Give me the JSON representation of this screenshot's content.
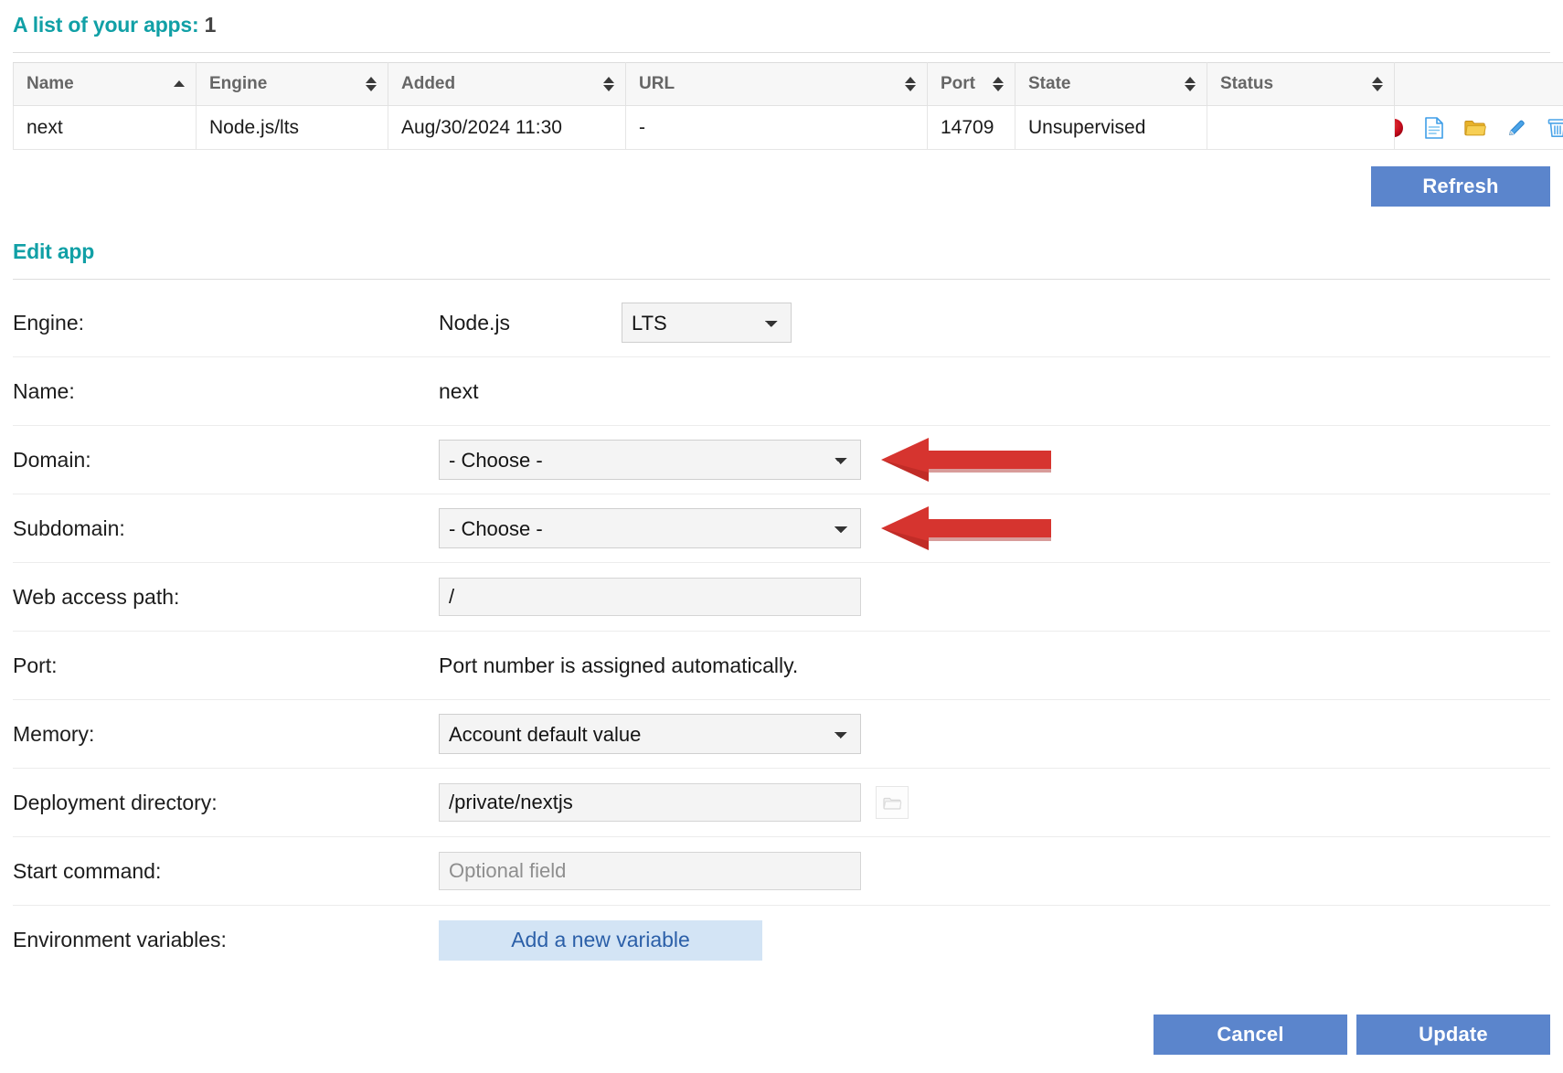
{
  "apps_section": {
    "title": "A list of your apps:",
    "count": "1",
    "columns": [
      {
        "label": "Name",
        "sort": "asc"
      },
      {
        "label": "Engine",
        "sort": "both"
      },
      {
        "label": "Added",
        "sort": "both"
      },
      {
        "label": "URL",
        "sort": "both"
      },
      {
        "label": "Port",
        "sort": "both"
      },
      {
        "label": "State",
        "sort": "both"
      },
      {
        "label": "Status",
        "sort": "both"
      },
      {
        "label": "",
        "sort": "none"
      }
    ],
    "rows": [
      {
        "name": "next",
        "engine": "Node.js/lts",
        "added": "Aug/30/2024 11:30",
        "url": "-",
        "port": "14709",
        "state": "Unsupervised",
        "status": "",
        "actions": [
          {
            "icon": "stop-circle-icon",
            "title": "Stop"
          },
          {
            "icon": "log-file-icon",
            "title": "Log"
          },
          {
            "icon": "folder-icon",
            "title": "Files"
          },
          {
            "icon": "pencil-edit-icon",
            "title": "Edit"
          },
          {
            "icon": "trash-delete-icon",
            "title": "Delete"
          }
        ]
      }
    ],
    "refresh_label": "Refresh"
  },
  "edit_section": {
    "title": "Edit app",
    "fields": {
      "engine_label": "Engine:",
      "engine_name": "Node.js",
      "engine_version": "LTS",
      "name_label": "Name:",
      "name_value": "next",
      "domain_label": "Domain:",
      "domain_value": "- Choose -",
      "subdomain_label": "Subdomain:",
      "subdomain_value": "- Choose -",
      "webpath_label": "Web access path:",
      "webpath_value": "/",
      "port_label": "Port:",
      "port_value": "Port number is assigned automatically.",
      "memory_label": "Memory:",
      "memory_value": "Account default value",
      "deploydir_label": "Deployment directory:",
      "deploydir_value": "/private/nextjs",
      "startcmd_label": "Start command:",
      "startcmd_placeholder": "Optional field",
      "envvars_label": "Environment variables:",
      "envvars_button": "Add a new variable"
    },
    "cancel_label": "Cancel",
    "update_label": "Update"
  },
  "annotations": [
    {
      "target": "domain-select",
      "type": "left-arrow",
      "color": "#d6342f"
    },
    {
      "target": "subdomain-select",
      "type": "left-arrow",
      "color": "#d6342f"
    }
  ],
  "colors": {
    "heading_teal": "#11a0a6",
    "button_blue": "#5b85cc",
    "addvar_bg": "#d3e4f5",
    "addvar_text": "#2b5fa8",
    "arrow_red": "#d6342f"
  }
}
